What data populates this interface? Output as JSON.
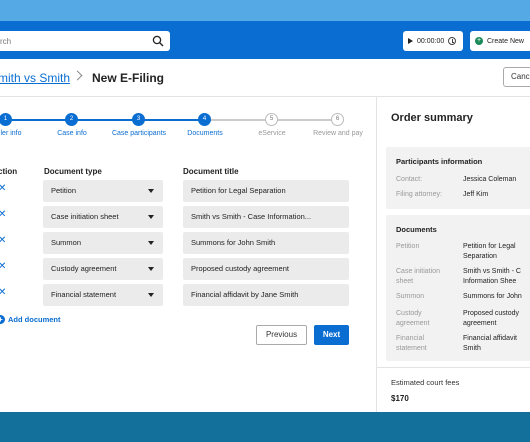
{
  "colors": {
    "brand_blue": "#0a6dd1",
    "top_strip": "#55a9e4",
    "bottom_band": "#13709a",
    "field_bg": "#ebebeb"
  },
  "topbar": {
    "search_placeholder": "rch",
    "search_icon": "search-icon",
    "timer_value": "00:00:00",
    "create_label": "Create New"
  },
  "header": {
    "breadcrumb_link": "mith vs Smith",
    "page_title": "New E-Filing",
    "cancel_label": "Cance"
  },
  "stepper": {
    "steps": [
      {
        "num": "1",
        "label": "ler info",
        "status": "done"
      },
      {
        "num": "2",
        "label": "Case info",
        "status": "done"
      },
      {
        "num": "3",
        "label": "Case participants",
        "status": "done"
      },
      {
        "num": "4",
        "label": "Documents",
        "status": "done"
      },
      {
        "num": "5",
        "label": "eService",
        "status": "todo"
      },
      {
        "num": "6",
        "label": "Review and pay",
        "status": "todo"
      }
    ]
  },
  "table": {
    "col_action": "ction",
    "col_type": "Document type",
    "col_title": "Document title",
    "remove_glyph": "✕",
    "rows": [
      {
        "type": "Petition",
        "title": "Petition for Legal Separation"
      },
      {
        "type": "Case initiation sheet",
        "title": "Smith vs Smith - Case Information..."
      },
      {
        "type": "Summon",
        "title": "Summons for John Smith"
      },
      {
        "type": "Custody agreement",
        "title": "Proposed custody agreement"
      },
      {
        "type": "Financial statement",
        "title": "Financial affidavit by Jane Smith"
      }
    ]
  },
  "actions": {
    "add_document": "Add document",
    "previous": "Previous",
    "next": "Next"
  },
  "summary": {
    "title": "Order summary",
    "participants": {
      "heading": "Participants information",
      "contact_label": "Contact:",
      "contact_value": "Jessica Coleman",
      "attorney_label": "Filing attorney:",
      "attorney_value": "Jeff Kim"
    },
    "documents": {
      "heading": "Documents",
      "items": [
        {
          "k1": "Petition",
          "k2": "",
          "v1": "Petition for Legal",
          "v2": "Separation"
        },
        {
          "k1": "Case initiation",
          "k2": "sheet",
          "v1": "Smith vs Smith - C",
          "v2": "Information Shee"
        },
        {
          "k1": "Summon",
          "k2": "",
          "v1": "Summons for John",
          "v2": ""
        },
        {
          "k1": "Custody",
          "k2": "agreement",
          "v1": "Proposed custody",
          "v2": "agreement"
        },
        {
          "k1": "Financial",
          "k2": "statement",
          "v1": "Financial affidavit",
          "v2": "Smith"
        }
      ]
    },
    "fees_label": "Estimated court fees",
    "fees_value": "$170"
  }
}
